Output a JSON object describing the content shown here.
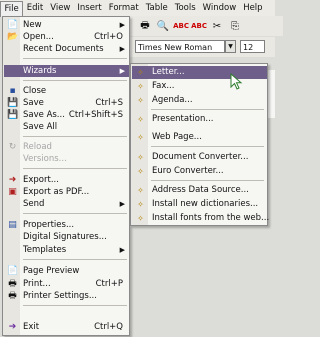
{
  "menubar": {
    "items": [
      "File",
      "Edit",
      "View",
      "Insert",
      "Format",
      "Table",
      "Tools",
      "Window",
      "Help"
    ]
  },
  "toolbar": {
    "font_name": "Times New Roman",
    "font_size": "12"
  },
  "file_menu": {
    "items": [
      {
        "label": "New",
        "icon": "new-document-icon",
        "submenu": true
      },
      {
        "label": "Open...",
        "icon": "open-folder-icon",
        "shortcut": "Ctrl+O"
      },
      {
        "label": "Recent Documents",
        "submenu": true
      },
      {
        "label": "Wizards",
        "submenu": true,
        "highlighted": true
      },
      {
        "label": "Close",
        "icon": "close-icon"
      },
      {
        "label": "Save",
        "icon": "save-icon",
        "shortcut": "Ctrl+S"
      },
      {
        "label": "Save As...",
        "icon": "save-as-icon",
        "shortcut": "Ctrl+Shift+S"
      },
      {
        "label": "Save All"
      },
      {
        "label": "Reload",
        "icon": "reload-icon",
        "disabled": true
      },
      {
        "label": "Versions...",
        "disabled": true
      },
      {
        "label": "Export...",
        "icon": "export-icon"
      },
      {
        "label": "Export as PDF...",
        "icon": "pdf-icon"
      },
      {
        "label": "Send",
        "submenu": true
      },
      {
        "label": "Properties...",
        "icon": "properties-icon"
      },
      {
        "label": "Digital Signatures..."
      },
      {
        "label": "Templates",
        "submenu": true
      },
      {
        "label": "Page Preview",
        "icon": "page-preview-icon"
      },
      {
        "label": "Print...",
        "icon": "print-icon",
        "shortcut": "Ctrl+P"
      },
      {
        "label": "Printer Settings...",
        "icon": "printer-settings-icon"
      },
      {
        "label": "Exit",
        "icon": "exit-icon",
        "shortcut": "Ctrl+Q"
      }
    ]
  },
  "wizards_menu": {
    "items": [
      {
        "label": "Letter...",
        "highlighted": true
      },
      {
        "label": "Fax..."
      },
      {
        "label": "Agenda..."
      },
      {
        "label": "Presentation..."
      },
      {
        "label": "Web Page..."
      },
      {
        "label": "Document Converter..."
      },
      {
        "label": "Euro Converter..."
      },
      {
        "label": "Address Data Source..."
      },
      {
        "label": "Install new dictionaries..."
      },
      {
        "label": "Install fonts from the web..."
      }
    ]
  }
}
